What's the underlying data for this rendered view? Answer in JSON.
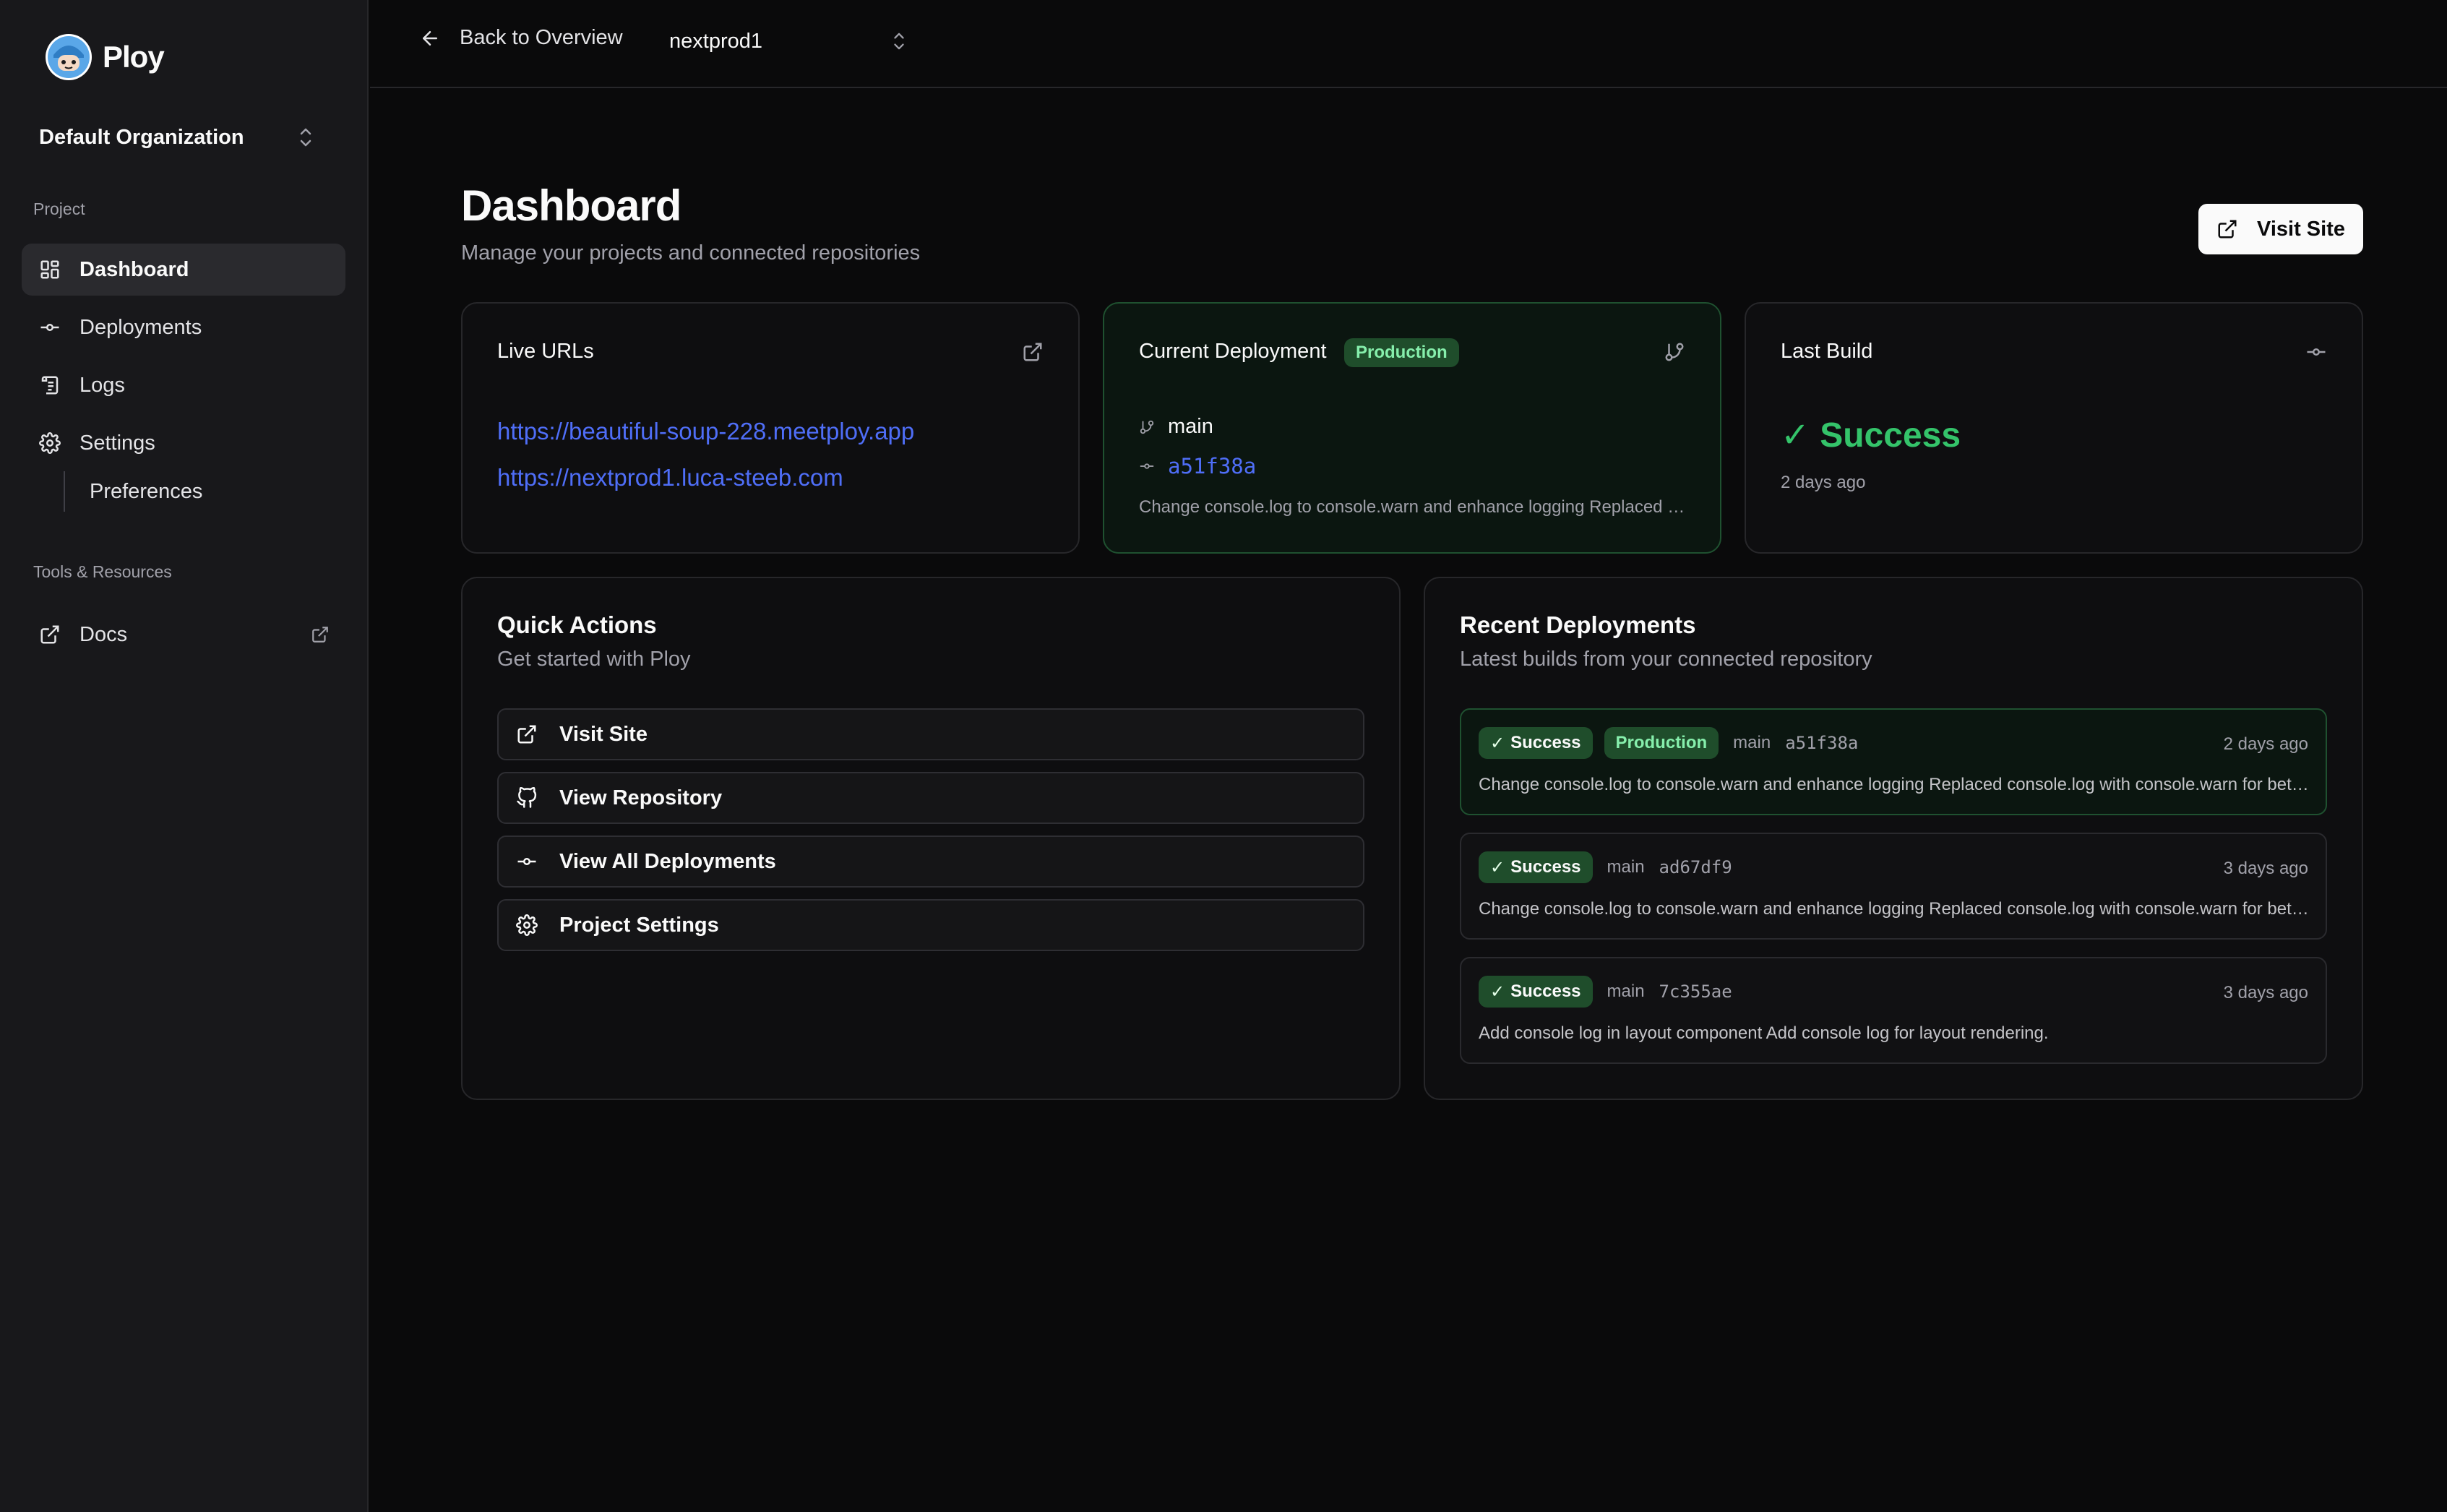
{
  "brand": {
    "name": "Ploy"
  },
  "sidebar": {
    "org": "Default Organization",
    "section_project": "Project",
    "section_tools": "Tools & Resources",
    "items": {
      "dashboard": "Dashboard",
      "deployments": "Deployments",
      "logs": "Logs",
      "settings": "Settings",
      "preferences": "Preferences",
      "docs": "Docs"
    }
  },
  "topbar": {
    "back_label": "Back to Overview",
    "project": "nextprod1"
  },
  "page": {
    "title": "Dashboard",
    "subtitle": "Manage your projects and connected repositories",
    "visit_button": "Visit Site"
  },
  "live_urls": {
    "title": "Live URLs",
    "urls": [
      "https://beautiful-soup-228.meetploy.app",
      "https://nextprod1.luca-steeb.com"
    ]
  },
  "current_deployment": {
    "title": "Current Deployment",
    "badge": "Production",
    "branch": "main",
    "commit": "a51f38a",
    "message": "Change console.log to console.warn and enhance logging Replaced console.log with console.warn for better visibility"
  },
  "last_build": {
    "title": "Last Build",
    "status": "Success",
    "time": "2 days ago"
  },
  "quick_actions": {
    "title": "Quick Actions",
    "subtitle": "Get started with Ploy",
    "items": [
      "Visit Site",
      "View Repository",
      "View All Deployments",
      "Project Settings"
    ]
  },
  "recent_deployments": {
    "title": "Recent Deployments",
    "subtitle": "Latest builds from your connected repository",
    "items": [
      {
        "status": "Success",
        "badge": "Production",
        "branch": "main",
        "hash": "a51f38a",
        "time": "2 days ago",
        "message": "Change console.log to console.warn and enhance logging Replaced console.log with console.warn for better visibility"
      },
      {
        "status": "Success",
        "branch": "main",
        "hash": "ad67df9",
        "time": "3 days ago",
        "message": "Change console.log to console.warn and enhance logging Replaced console.log with console.warn for better visibility"
      },
      {
        "status": "Success",
        "branch": "main",
        "hash": "7c355ae",
        "time": "3 days ago",
        "message": "Add console log in layout component Add console log for layout rendering."
      }
    ]
  },
  "colors": {
    "accent_link": "#4f6ef7",
    "success": "#34c36a",
    "badge_bg": "#1f4d2b"
  }
}
